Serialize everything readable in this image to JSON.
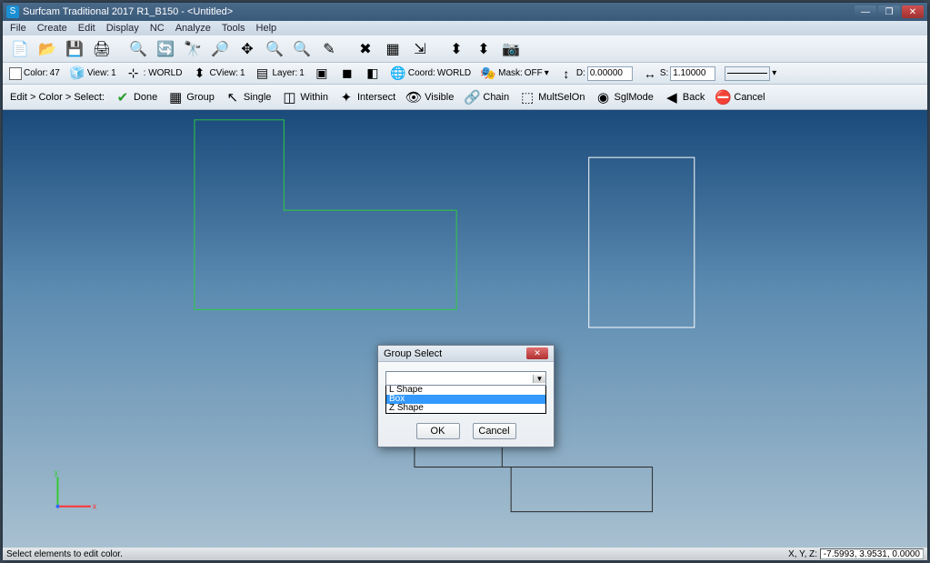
{
  "title": "Surfcam Traditional 2017 R1_B150 - <Untitled>",
  "menu": [
    "File",
    "Create",
    "Edit",
    "Display",
    "NC",
    "Analyze",
    "Tools",
    "Help"
  ],
  "props": {
    "color_label": "Color:",
    "color_value": "47",
    "view_label": "View:",
    "view_value": "1",
    "orient_label": ": WORLD",
    "cview_label": "CView:",
    "cview_value": "1",
    "layer_label": "Layer:",
    "layer_value": "1",
    "coord_label": "Coord:",
    "coord_value": "WORLD",
    "mask_label": "Mask:",
    "mask_value": "OFF",
    "d_label": "D:",
    "d_value": "0.00000",
    "s_label": "S:",
    "s_value": "1.10000"
  },
  "breadcrumb": "Edit > Color > Select:",
  "actions": {
    "done": "Done",
    "group": "Group",
    "single": "Single",
    "within": "Within",
    "intersect": "Intersect",
    "visible": "Visible",
    "chain": "Chain",
    "multisel": "MultSelOn",
    "sglmode": "SglMode",
    "back": "Back",
    "cancel": "Cancel"
  },
  "dialog": {
    "title": "Group Select",
    "items": [
      "L Shape",
      "Box",
      "Z Shape"
    ],
    "selected": 1,
    "ok": "OK",
    "cancel": "Cancel"
  },
  "status": {
    "msg": "Select elements to edit color.",
    "xyz_label": "X, Y, Z:",
    "xyz": "-7.5993, 3.9531, 0.0000"
  }
}
